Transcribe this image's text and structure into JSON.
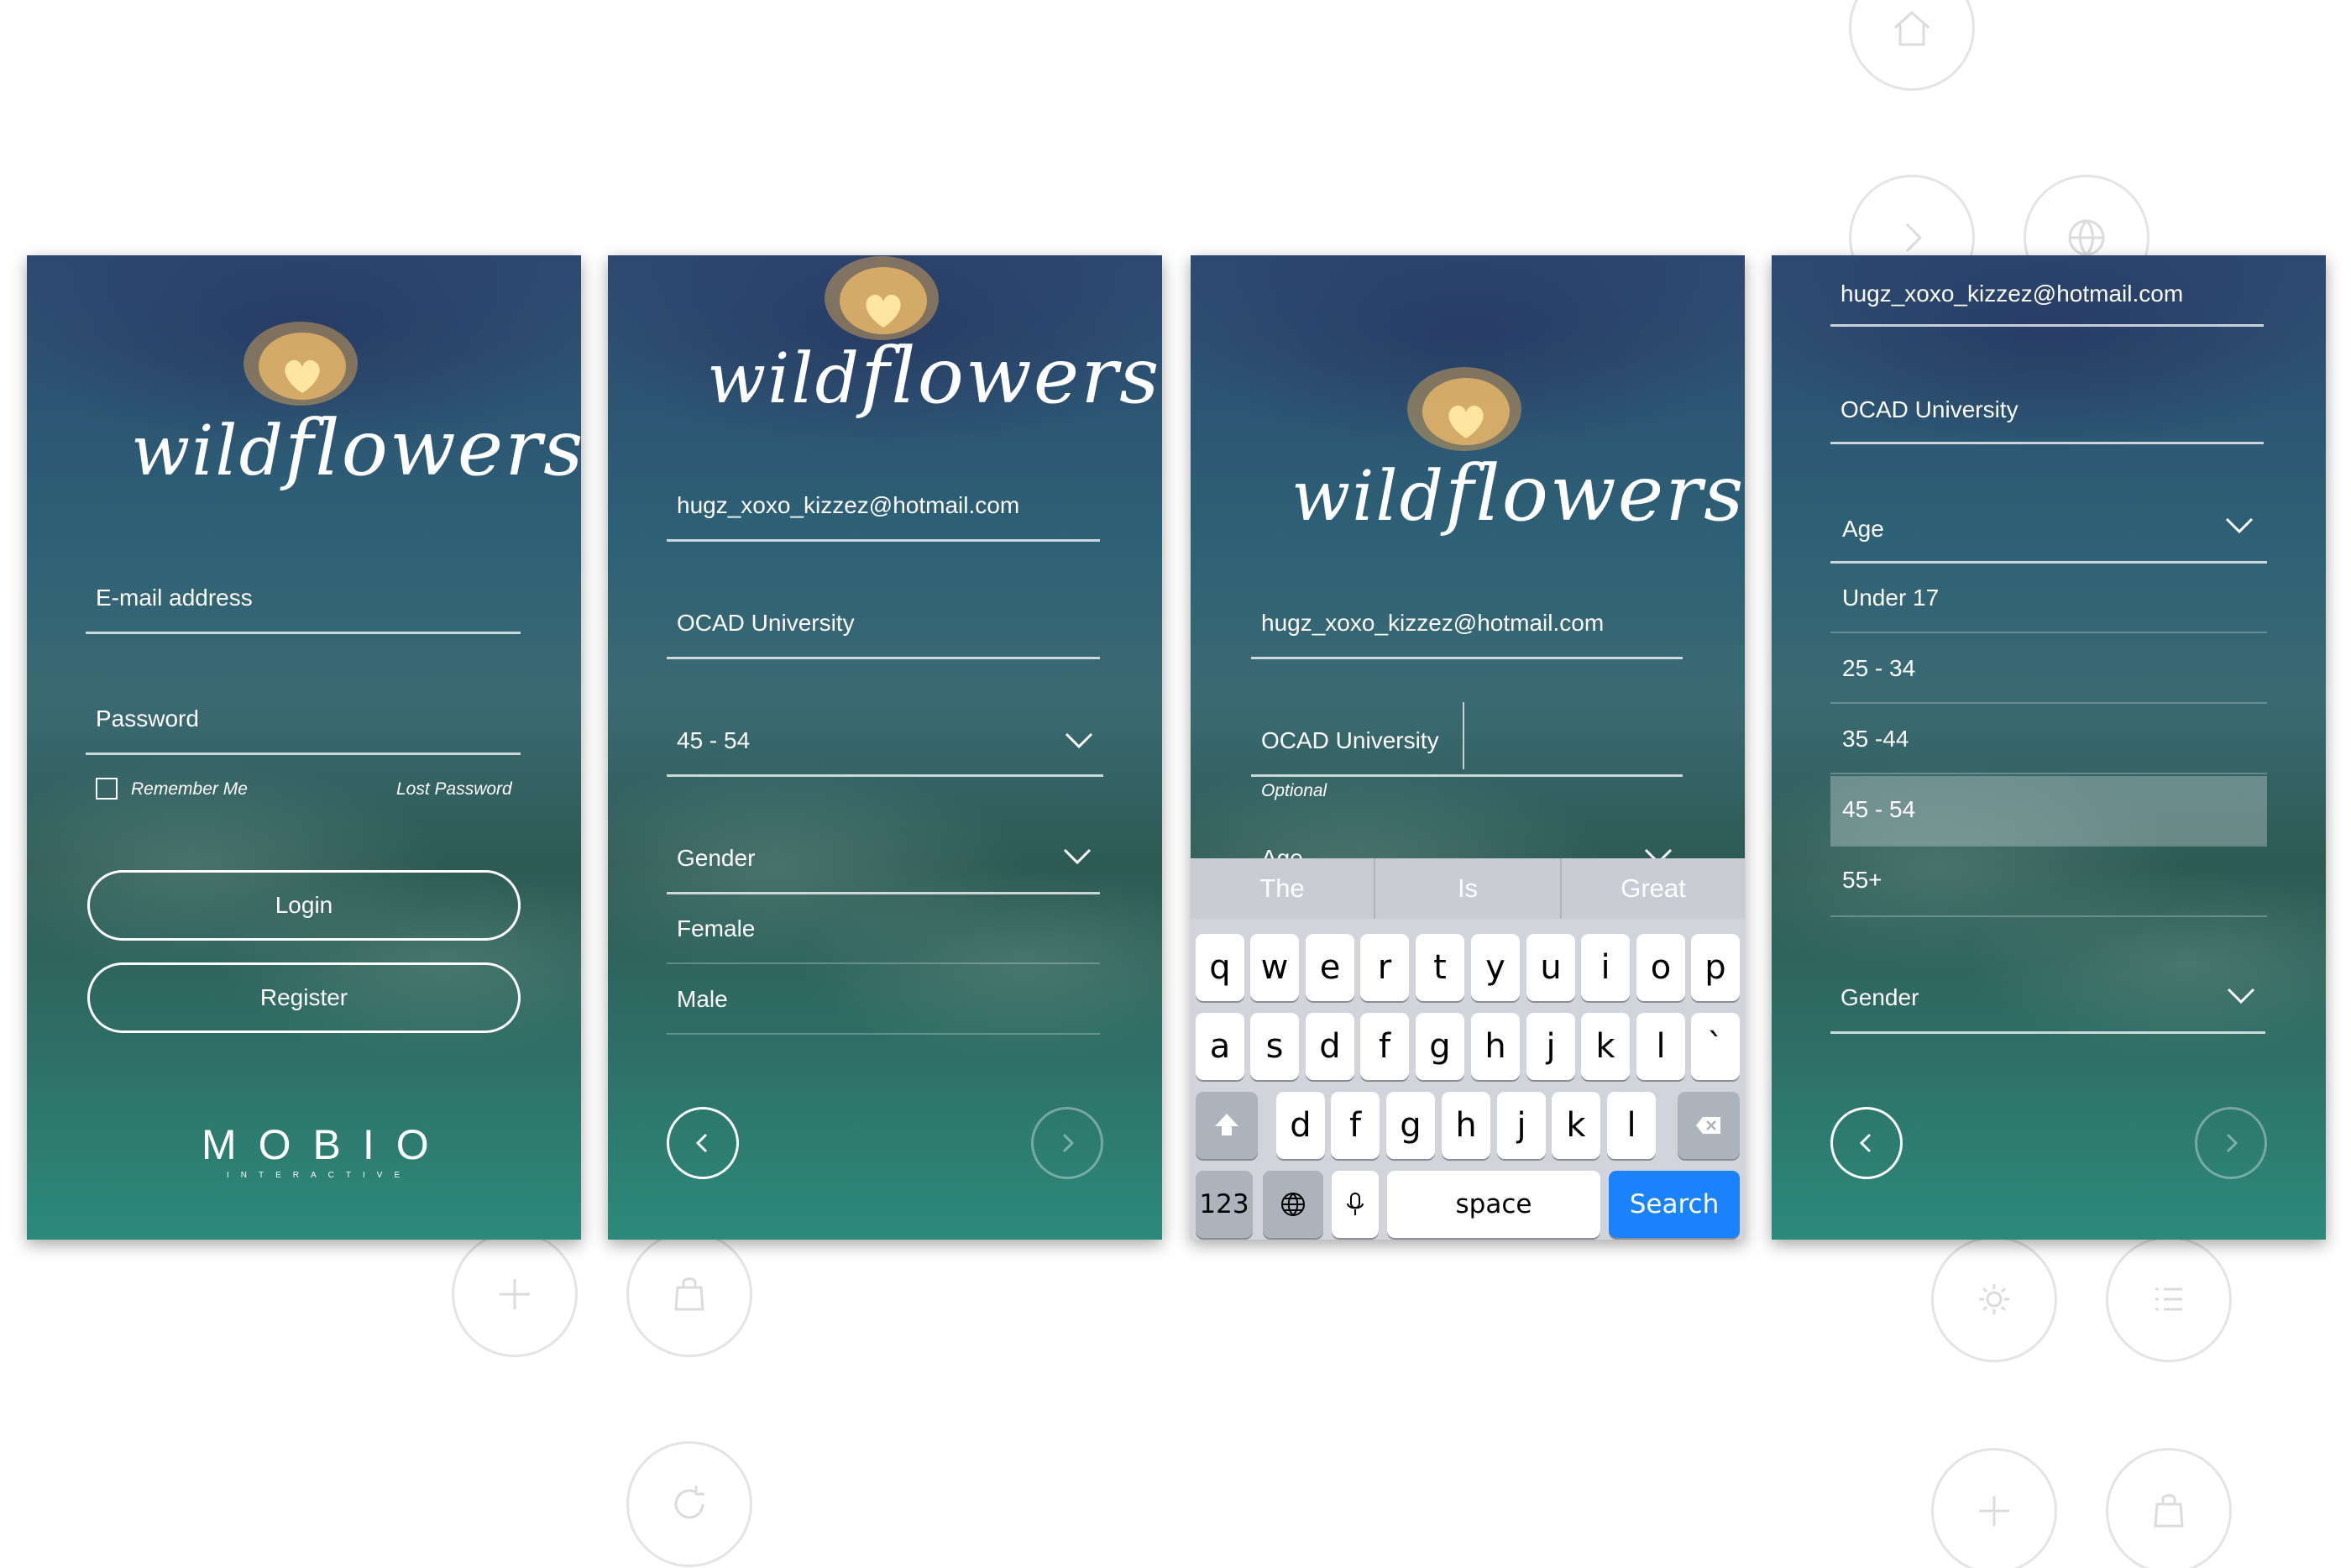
{
  "app": {
    "logo_text_a": "wild",
    "logo_text_b": "flowers",
    "logo_text_c": "ers"
  },
  "colors": {
    "keyboard_accent": "#1a82fb",
    "flower_gold": "#e8b86a",
    "flower_light": "#ffe6a0"
  },
  "background_icons": [
    "home-icon",
    "chevron-right-icon",
    "globe-icon",
    "plus-icon",
    "bag-icon",
    "refresh-icon",
    "gear-icon",
    "list-icon",
    "plus-icon",
    "bag-icon"
  ],
  "login": {
    "email_placeholder": "E-mail address",
    "password_placeholder": "Password",
    "remember_label": "Remember Me",
    "lost_password_label": "Lost Password",
    "login_label": "Login",
    "register_label": "Register",
    "brand": "MOBIO",
    "brand_sub": "INTERACTIVE"
  },
  "register_gender": {
    "email_value": "hugz_xoxo_kizzez@hotmail.com",
    "school_value": "OCAD University",
    "age_value": "45 - 54",
    "gender_label": "Gender",
    "gender_options": [
      "Female",
      "Male"
    ]
  },
  "register_keyboard": {
    "email_value": "hugz_xoxo_kizzez@hotmail.com",
    "school_value": "OCAD University",
    "optional_label": "Optional",
    "age_label_partial": "Age",
    "suggestions": [
      "The",
      "Is",
      "Great"
    ],
    "row1": [
      "q",
      "w",
      "e",
      "r",
      "t",
      "y",
      "u",
      "i",
      "o",
      "p"
    ],
    "row2": [
      "a",
      "s",
      "d",
      "f",
      "g",
      "h",
      "j",
      "k",
      "l",
      "`"
    ],
    "row3": [
      "d",
      "f",
      "g",
      "h",
      "j",
      "k",
      "l"
    ],
    "numbers_label": "123",
    "space_label": "space",
    "search_label": "Search"
  },
  "register_age": {
    "email_value": "hugz_xoxo_kizzez@hotmail.com",
    "school_value": "OCAD University",
    "age_label": "Age",
    "age_options": [
      "Under 17",
      "25 - 34",
      "35 -44",
      "45 - 54",
      "55+"
    ],
    "selected_age": "45 - 54",
    "gender_label": "Gender"
  }
}
